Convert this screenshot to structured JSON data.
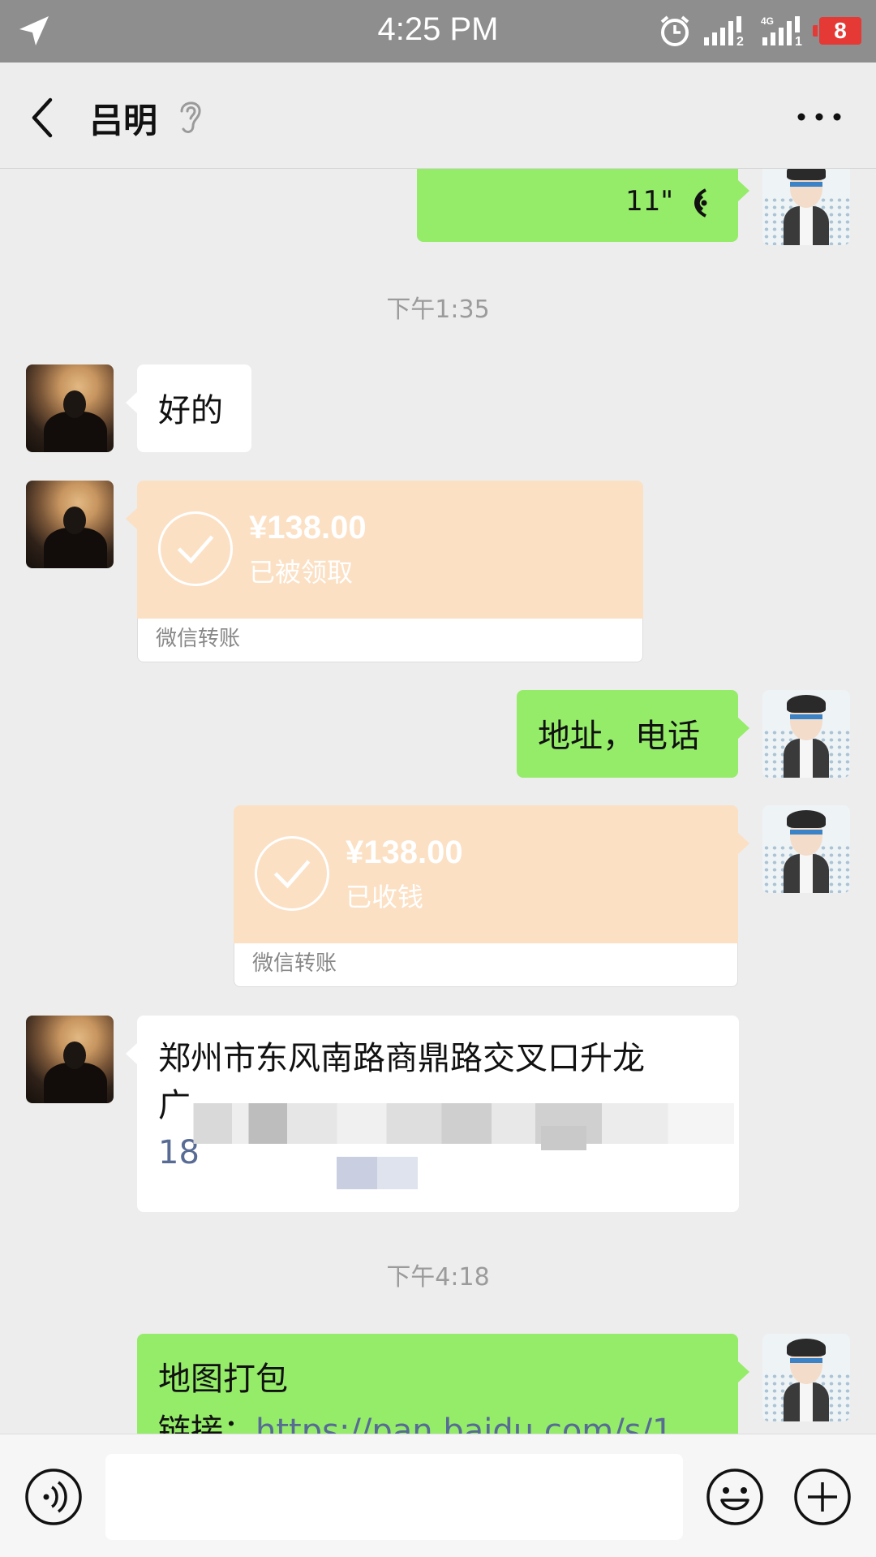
{
  "status_bar": {
    "time": "4:25 PM",
    "sim1": "2",
    "sim2_label": "4G",
    "sim2": "1",
    "battery": "8"
  },
  "header": {
    "contact_name": "吕明"
  },
  "messages": {
    "voice_duration": "11\"",
    "time1": "下午1:35",
    "text_ok": "好的",
    "transfer1_amount": "¥138.00",
    "transfer1_status": "已被领取",
    "transfer1_footer": "微信转账",
    "text_address_phone": "地址，电话",
    "transfer2_amount": "¥138.00",
    "transfer2_status": "已收钱",
    "transfer2_footer": "微信转账",
    "address_line1": "郑州市东风南路商鼎路交叉口升龙",
    "address_line2": "广",
    "phone": "18",
    "time2": "下午4:18",
    "pkg_title": "地图打包",
    "pkg_link_label": "链接：",
    "pkg_link": "https://pan.baidu.com/s/1"
  },
  "colors": {
    "sent_bubble": "#95ec69",
    "received_bubble": "#ffffff",
    "transfer": "#fbe0c4",
    "background": "#ededed",
    "link": "#576b95"
  },
  "icons": [
    "location-arrow-icon",
    "alarm-icon",
    "signal-icon",
    "battery-icon",
    "back-icon",
    "ear-icon",
    "more-icon",
    "voice-wave-icon",
    "check-circle-icon",
    "voice-input-icon",
    "emoji-icon",
    "plus-icon"
  ]
}
